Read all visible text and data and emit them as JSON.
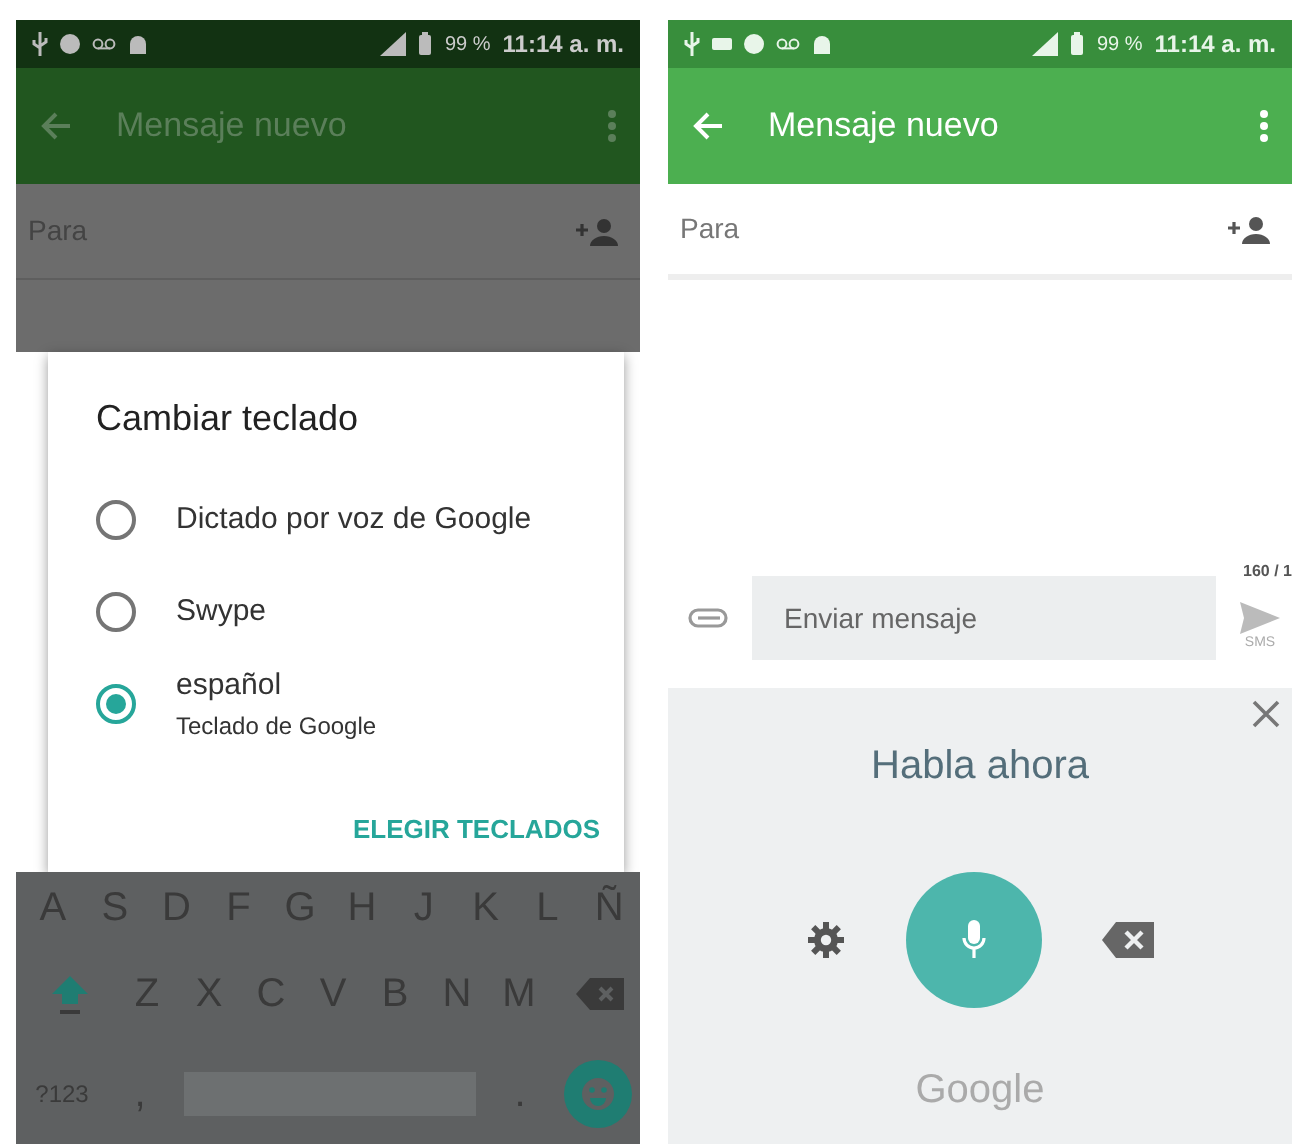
{
  "left_screen": {
    "status_bar": {
      "battery": "99 %",
      "time": "11:14 a. m."
    },
    "app_bar": {
      "title": "Mensaje nuevo"
    },
    "recipient": {
      "placeholder": "Para"
    },
    "dialog": {
      "title": "Cambiar teclado",
      "options": [
        {
          "label": "Dictado por voz de Google",
          "selected": false
        },
        {
          "label": "Swype",
          "selected": false
        },
        {
          "label": "español",
          "sublabel": "Teclado de Google",
          "selected": true
        }
      ],
      "action": "ELEGIR TECLADOS"
    },
    "keyboard": {
      "rows": [
        [
          "A",
          "S",
          "D",
          "F",
          "G",
          "H",
          "J",
          "K",
          "L",
          "Ñ"
        ],
        [
          "Z",
          "X",
          "C",
          "V",
          "B",
          "N",
          "M"
        ]
      ],
      "symbols_key": "?123",
      "comma": ",",
      "period": "."
    }
  },
  "right_screen": {
    "status_bar": {
      "battery": "99 %",
      "time": "11:14 a. m."
    },
    "app_bar": {
      "title": "Mensaje nuevo"
    },
    "recipient": {
      "placeholder": "Para"
    },
    "compose": {
      "placeholder": "Enviar mensaje",
      "counter": "160 / 1",
      "send_label": "SMS"
    },
    "voice": {
      "prompt": "Habla ahora",
      "brand": "Google"
    }
  }
}
